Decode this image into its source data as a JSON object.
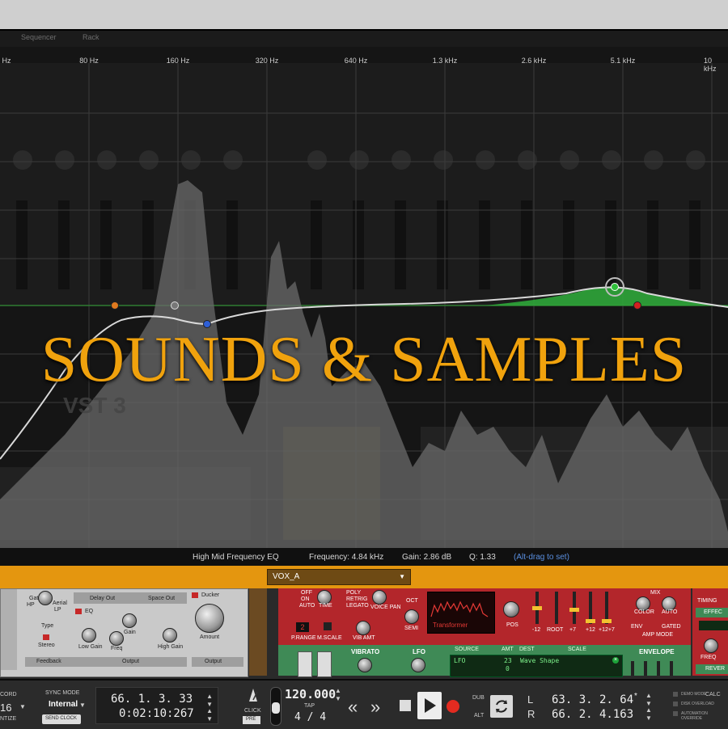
{
  "window": {
    "tabs": [
      "Sequencer",
      "Rack"
    ]
  },
  "eq": {
    "freq_labels": [
      "Hz",
      "80 Hz",
      "160 Hz",
      "320 Hz",
      "640 Hz",
      "1.3 kHz",
      "2.6 kHz",
      "5.1 kHz",
      "10 kHz"
    ],
    "plugin_ghost_label": "VST 3"
  },
  "overlay": {
    "title": "SOUNDS & SAMPLES",
    "title_color": "#f0a20d"
  },
  "infobar": {
    "band_name": "High Mid Frequency EQ",
    "frequency": "Frequency: 4.84 kHz",
    "gain": "Gain: 2.86 dB",
    "q": "Q: 1.33",
    "hint": "(Alt-drag to set)"
  },
  "track_select": {
    "value": "VOX_A"
  },
  "rack": {
    "left_panel": {
      "sections": [
        "Delay Out",
        "Space Out",
        "Ducker"
      ],
      "eq_label": "EQ",
      "knobs": [
        "Low Gain",
        "Gain",
        "Freq",
        "High Gain",
        "Amount"
      ],
      "labels": [
        "Type",
        "Stereo",
        "Feedback",
        "Output",
        "Output"
      ],
      "filters": [
        "Gate",
        "Aerial",
        "HP",
        "LP"
      ]
    },
    "synth_panel": {
      "buttons": [
        "OFF",
        "ON",
        "AUTO",
        "TIME",
        "POLY",
        "RETRIG",
        "LEGATO",
        "VOICE PAN",
        "OCT",
        "SEMI",
        "P.RANGE",
        "M.SCALE",
        "VIB AMT",
        "POS"
      ],
      "bend_value": "2",
      "wave_name": "Transformer",
      "pitch_marks": [
        "-12",
        "ROOT",
        "+7",
        "+12",
        "+12+7"
      ],
      "amp": [
        "MIX",
        "COLOR",
        "AUTO",
        "ENV",
        "GATED",
        "AMP MODE"
      ],
      "mod_sections": [
        "VIBRATO",
        "LFO",
        "ENVELOPE"
      ],
      "mod_table_headers": [
        "SOURCE",
        "AMT",
        "DEST",
        "SCALE"
      ],
      "mod_row": {
        "source": "LFO",
        "amt": "23",
        "dest": "Wave Shape",
        "amt2": "0"
      },
      "right_labels": [
        "TIMING",
        "EFFEC",
        "REVER",
        "FREQ"
      ]
    }
  },
  "transport": {
    "record_label": "CORD",
    "quantize_value": "16",
    "quantize_label": "NTIZE",
    "sync_mode_label": "SYNC MODE",
    "sync_mode_value": "Internal",
    "send_clock": "SEND CLOCK",
    "position_bars": "66. 1. 3. 33",
    "position_time": "0:02:10:267",
    "click_label": "CLICK",
    "pre_label": "PRE",
    "tempo": "120.000",
    "tap_label": "TAP",
    "signature": "4 / 4",
    "dub_label": "DUB",
    "alt_label": "ALT",
    "loop_left_label": "L",
    "loop_right_label": "R",
    "loop_left": "63. 3. 2. 64",
    "loop_right": "66. 2. 4.163",
    "status": [
      "DEMO MODE",
      "DISK OVERLOAD",
      "AUTOMATION OVERRIDE"
    ],
    "calc_label": "CALC"
  }
}
